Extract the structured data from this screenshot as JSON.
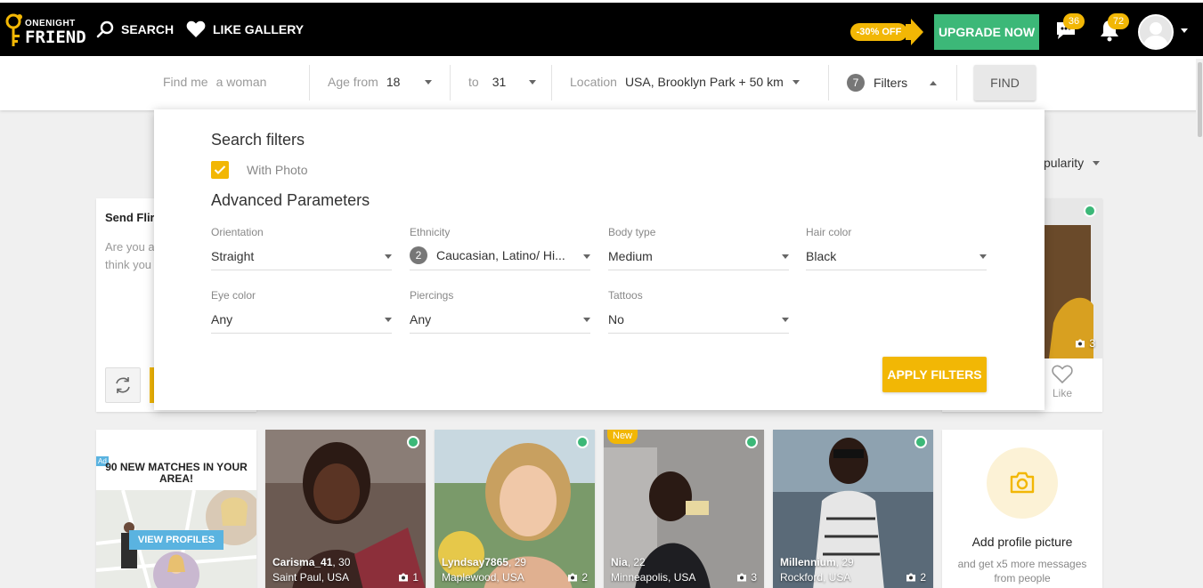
{
  "brand": {
    "logo_line1": "ONENIGHT",
    "logo_line2": "FRIEND",
    "accent_color": "#f2b705",
    "green_color": "#3cb878"
  },
  "nav": {
    "search_label": "SEARCH",
    "like_gallery_label": "LIKE GALLERY",
    "promo_label": "-30% OFF",
    "upgrade_label": "UPGRADE NOW",
    "messages_count": "36",
    "notifications_count": "72"
  },
  "searchbar": {
    "find_me_label": "Find me",
    "find_me_value": "a woman",
    "age_from_label": "Age from",
    "age_from_value": "18",
    "age_to_label": "to",
    "age_to_value": "31",
    "location_label": "Location",
    "location_value": "USA, Brooklyn Park + 50 km",
    "filters_count": "7",
    "filters_label": "Filters",
    "find_button": "FIND"
  },
  "sort": {
    "visible_text": "pularity"
  },
  "flirt_card": {
    "title": "Send Flir",
    "text": "Are you a think you"
  },
  "filters_panel": {
    "title": "Search filters",
    "with_photo_label": "With Photo",
    "with_photo_checked": true,
    "advanced_title": "Advanced Parameters",
    "fields": [
      {
        "label": "Orientation",
        "value": "Straight",
        "count": ""
      },
      {
        "label": "Ethnicity",
        "value": "Caucasian, Latino/ Hi...",
        "count": "2"
      },
      {
        "label": "Body type",
        "value": "Medium",
        "count": ""
      },
      {
        "label": "Hair color",
        "value": "Black",
        "count": ""
      },
      {
        "label": "Eye color",
        "value": "Any",
        "count": ""
      },
      {
        "label": "Piercings",
        "value": "Any",
        "count": ""
      },
      {
        "label": "Tattoos",
        "value": "No",
        "count": ""
      }
    ],
    "apply_label": "APPLY FILTERS"
  },
  "top_right_card": {
    "photo_count": "3",
    "like_label": "Like"
  },
  "ad_card": {
    "ad_tag": "Ad",
    "title": "90 NEW MATCHES IN YOUR AREA!",
    "button": "VIEW PROFILES"
  },
  "profiles": [
    {
      "name": "Carisma_41",
      "age": ", 30",
      "location": "Saint Paul, USA",
      "photos": "1",
      "online": true,
      "is_new": false
    },
    {
      "name": "Lyndsay7865",
      "age": ", 29",
      "location": "Maplewood, USA",
      "photos": "2",
      "online": true,
      "is_new": false
    },
    {
      "name": "Nia",
      "age": ", 22",
      "location": "Minneapolis, USA",
      "photos": "3",
      "online": true,
      "is_new": true,
      "new_label": "New"
    },
    {
      "name": "Millennium",
      "age": ", 29",
      "location": "Rockford, USA",
      "photos": "2",
      "online": true,
      "is_new": false
    }
  ],
  "add_picture_card": {
    "title": "Add profile picture",
    "subtitle": "and get x5 more messages from people"
  }
}
